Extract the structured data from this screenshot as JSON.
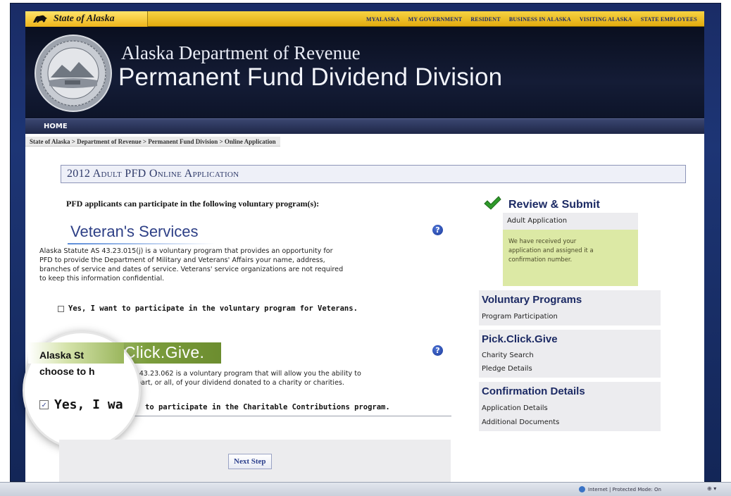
{
  "topbar": {
    "brand": "State of Alaska",
    "links": [
      "MYALASKA",
      "MY GOVERNMENT",
      "RESIDENT",
      "BUSINESS IN ALASKA",
      "VISITING ALASKA",
      "STATE EMPLOYEES"
    ]
  },
  "banner": {
    "department": "Alaska Department of Revenue",
    "division": "Permanent Fund Dividend Division"
  },
  "nav": {
    "home": "HOME"
  },
  "breadcrumb": "State of Alaska > Department of Revenue > Permanent Fund Division > Online Application",
  "page": {
    "title": "2012 Adult PFD Online Application",
    "intro": "PFD applicants can participate in the following voluntary program(s):"
  },
  "veterans": {
    "title": "Veteran's Services",
    "help": "?",
    "body_lines": [
      "Alaska Statute AS 43.23.015(j) is a voluntary program that provides an opportunity for",
      "PFD to provide the Department of Military and Veterans' Affairs your name, address,",
      "branches of service and dates of service. Veterans' service organizations are not required",
      "to keep this information confidential."
    ],
    "checkbox_label": "Yes, I want to participate in the voluntary program for Veterans.",
    "checked": false
  },
  "pick_click_give": {
    "title": "Click.Give.",
    "help": "?",
    "prefix": "Alaska St",
    "line1_start": "choose to h",
    "body_lines": [
      "AS 43.23.062 is a voluntary program that will allow you the ability to",
      "part, or all, of your dividend donated to a charity or charities."
    ],
    "checkbox_big": "Yes, I wa",
    "checkbox_rest": "to participate in the Charitable Contributions program.",
    "checked": true,
    "check_glyph": "✓"
  },
  "buttons": {
    "next": "Next Step"
  },
  "sidebar": {
    "review_title": "Review & Submit",
    "review_item": "Adult Application",
    "notice_lines": [
      "We have received your",
      "application and assigned it a",
      "confirmation number."
    ],
    "voluntary_title": "Voluntary Programs",
    "voluntary_items": [
      "Program Participation"
    ],
    "pcg_title": "Pick.Click.Give",
    "pcg_items": [
      "Charity Search",
      "Pledge Details"
    ],
    "confirmation_title": "Confirmation Details",
    "confirmation_items": [
      "Application Details",
      "Additional Documents"
    ]
  },
  "status": {
    "zone": "Internet | Protected Mode: On",
    "zoom": "⊕ ▾"
  },
  "colors": {
    "navy": "#1c2a64",
    "gold": "#e3ac0f",
    "green": "#6c8d2f",
    "notice": "#dce9a5"
  }
}
